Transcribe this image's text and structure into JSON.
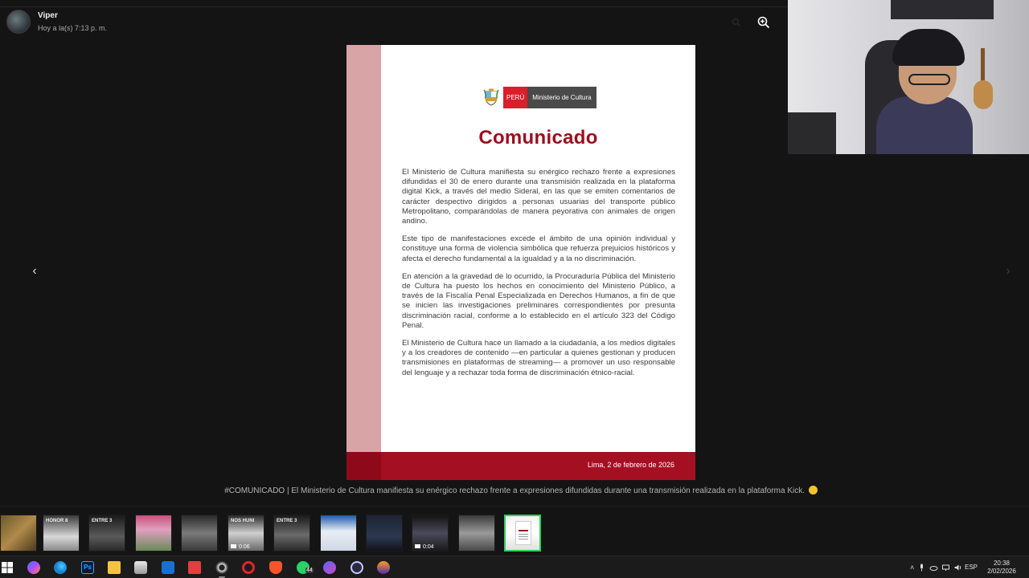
{
  "header": {
    "sender_name": "Viper",
    "timestamp": "Hoy a la(s) 7:13 p. m."
  },
  "icons": {
    "zoom": "zoom-in-icon",
    "prev": "chevron-left-icon",
    "next": "chevron-right-icon"
  },
  "document": {
    "logo_country": "PERÚ",
    "logo_ministry": "Ministerio de Cultura",
    "title": "Comunicado",
    "paragraphs": [
      "El Ministerio de Cultura manifiesta su enérgico rechazo frente a expresiones difundidas el 30 de enero durante una transmisión realizada en la plataforma digital Kick, a través del medio Sideral, en las que se emiten comentarios de carácter despectivo dirigidos a personas usuarias del transporte público Metropolitano, comparándolas de manera peyorativa con animales de origen andino.",
      "Este tipo de manifestaciones excede el ámbito de una opinión individual y constituye una forma de violencia simbólica que refuerza prejuicios históricos y afecta el derecho fundamental a la igualdad y a la no discriminación.",
      "En atención a la gravedad de lo ocurrido, la Procuraduría Pública del Ministerio de Cultura ha puesto los hechos en conocimiento del Ministerio Público, a través de la Fiscalía Penal Especializada en Derechos Humanos, a fin de que se inicien las investigaciones preliminares correspondientes por presunta discriminación racial, conforme a lo establecido en el artículo 323 del Código Penal.",
      "El Ministerio de Cultura hace un llamado a la ciudadanía, a los medios digitales y a los creadores de contenido —en particular a quienes gestionan y producen transmisiones en plataformas de streaming— a promover un uso responsable del lenguaje y a rechazar toda forma de discriminación étnico-racial."
    ],
    "footer_date": "Lima, 2 de febrero de 2026",
    "colors": {
      "accent": "#9b0e1e",
      "band": "#d9a4a5",
      "footer": "#a50f22"
    }
  },
  "caption": "#COMUNICADO | El Ministerio de Cultura manifiesta su enérgico rechazo frente a expresiones difundidas durante una transmisión realizada en la plataforma Kick.",
  "thumbnails": [
    {
      "caption": "",
      "duration": ""
    },
    {
      "caption": "HONOR 8",
      "duration": ""
    },
    {
      "caption": "ENTRE 3",
      "duration": ""
    },
    {
      "caption": "",
      "duration": ""
    },
    {
      "caption": "",
      "duration": ""
    },
    {
      "caption": "NOS HUNI",
      "duration": "0:06"
    },
    {
      "caption": "ENTRE 3",
      "duration": ""
    },
    {
      "caption": "",
      "duration": ""
    },
    {
      "caption": "",
      "duration": ""
    },
    {
      "caption": "",
      "duration": "0:04"
    },
    {
      "caption": "",
      "duration": ""
    },
    {
      "caption": "",
      "duration": ""
    }
  ],
  "taskbar": {
    "whatsapp_badge": "44",
    "language": "ESP",
    "time": "20:38",
    "date": "2/02/2026"
  }
}
